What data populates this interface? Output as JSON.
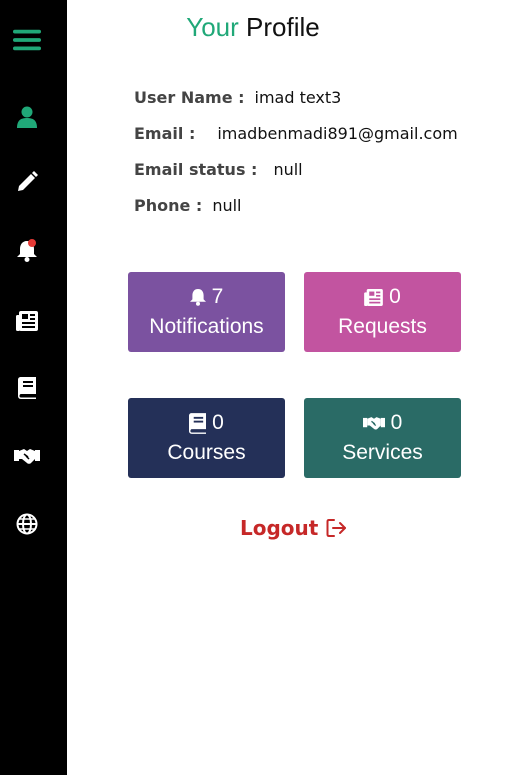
{
  "header": {
    "title_accent": "Your",
    "title_rest": "Profile"
  },
  "sidebar": {
    "items": [
      {
        "icon": "menu-icon",
        "color": "#20a878"
      },
      {
        "icon": "user-icon",
        "color": "#20a878"
      },
      {
        "icon": "pencil-icon",
        "color": "#ffffff"
      },
      {
        "icon": "bell-icon",
        "color": "#ffffff",
        "badge_color": "#e53935"
      },
      {
        "icon": "newspaper-icon",
        "color": "#ffffff"
      },
      {
        "icon": "book-icon",
        "color": "#ffffff"
      },
      {
        "icon": "handshake-icon",
        "color": "#ffffff"
      },
      {
        "icon": "globe-icon",
        "color": "#ffffff"
      }
    ]
  },
  "profile": {
    "username_label": "User Name :",
    "username_value": "imad text3",
    "email_label": "Email :",
    "email_value": "imadbenmadi891@gmail.com",
    "email_status_label": "Email status :",
    "email_status_value": "null",
    "phone_label": "Phone :",
    "phone_value": "null"
  },
  "cards": [
    {
      "count": "7",
      "label": "Notifications",
      "icon": "bell-icon",
      "color": "#7b52a0"
    },
    {
      "count": "0",
      "label": "Requests",
      "icon": "newspaper-icon",
      "color": "#c254a0"
    },
    {
      "count": "0",
      "label": "Courses",
      "icon": "book-icon",
      "color": "#243058"
    },
    {
      "count": "0",
      "label": "Services",
      "icon": "handshake-icon",
      "color": "#2a6b66"
    }
  ],
  "logout": {
    "label": "Logout",
    "icon": "logout-icon",
    "color": "#c62828"
  }
}
